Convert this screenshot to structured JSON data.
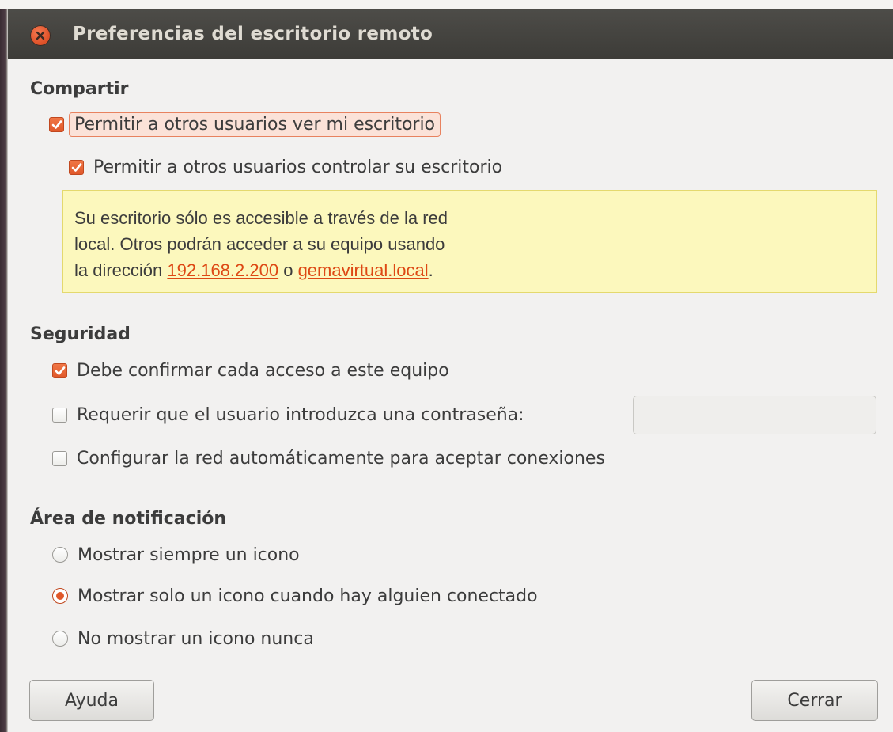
{
  "window": {
    "title": "Preferencias del escritorio remoto"
  },
  "sharing": {
    "heading": "Compartir",
    "allow_view": {
      "label": "Permitir a otros usuarios ver mi escritorio",
      "checked": true
    },
    "allow_control": {
      "label": "Permitir a otros usuarios controlar su escritorio",
      "checked": true
    },
    "info": {
      "line1": "Su escritorio sólo es accesible a través de la red",
      "line2": "local. Otros podrán acceder a su equipo usando",
      "line3_prefix": "la dirección ",
      "ip_address": "192.168.2.200",
      "connector": " o ",
      "hostname": "gemavirtual.local",
      "line3_suffix": "."
    }
  },
  "security": {
    "heading": "Seguridad",
    "confirm_access": {
      "label": "Debe confirmar cada acceso a este equipo",
      "checked": true
    },
    "require_password": {
      "label": "Requerir que el usuario introduzca una contraseña:",
      "checked": false
    },
    "password_value": "",
    "auto_network": {
      "label": "Configurar la red automáticamente para aceptar conexiones",
      "checked": false
    }
  },
  "notification": {
    "heading": "Área de notificación",
    "options": [
      {
        "label": "Mostrar siempre un icono",
        "selected": false
      },
      {
        "label": "Mostrar solo un icono cuando hay alguien conectado",
        "selected": true
      },
      {
        "label": "No mostrar un icono nunca",
        "selected": false
      }
    ]
  },
  "buttons": {
    "help": "Ayuda",
    "close": "Cerrar"
  },
  "colors": {
    "accent": "#e0582a",
    "info_background": "#fcf8bd",
    "titlebar": "#45443f"
  }
}
